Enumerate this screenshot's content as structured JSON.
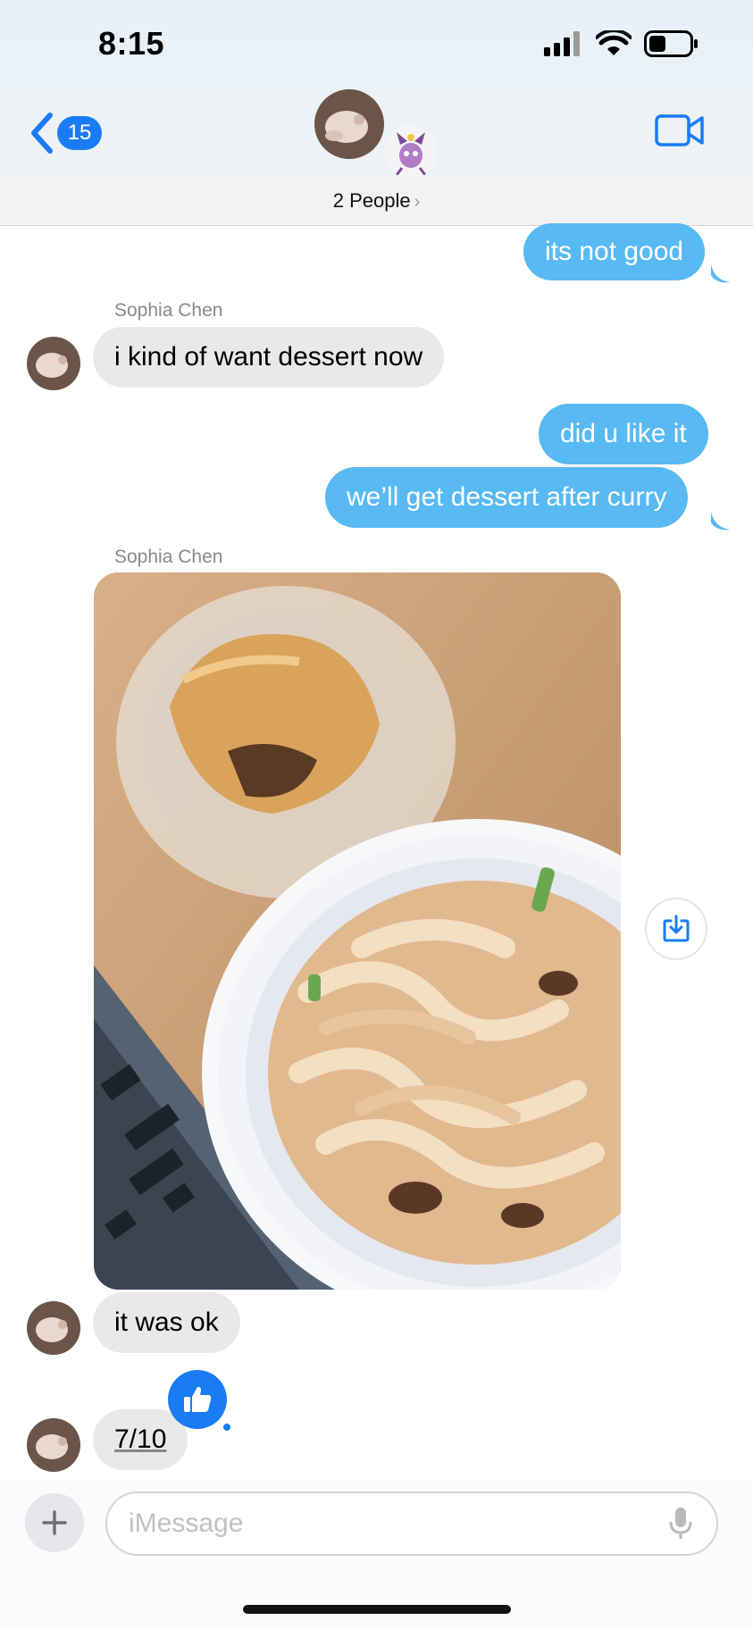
{
  "status_bar": {
    "time": "8:15"
  },
  "header": {
    "back_count": "15",
    "people_label": "2 People",
    "chevron": "›"
  },
  "messages": [
    {
      "direction": "out",
      "text": "its not good"
    },
    {
      "sender": "Sophia Chen"
    },
    {
      "direction": "in",
      "text": "i kind of want dessert now"
    },
    {
      "direction": "out",
      "text": "did u like it"
    },
    {
      "direction": "out",
      "text": "we’ll get dessert after curry"
    },
    {
      "sender": "Sophia Chen"
    },
    {
      "direction": "in",
      "type": "photo",
      "description": ""
    },
    {
      "direction": "in",
      "text": "it was ok"
    },
    {
      "direction": "in",
      "text": "7/10",
      "reaction": "thumbs-up-icon"
    }
  ],
  "composer": {
    "placeholder": "iMessage"
  },
  "colors": {
    "accent": "#1a7cf4",
    "outgoing_bubble": "#58b9f3",
    "incoming_bubble": "#e9e9eb"
  },
  "icons": [
    "back-chevron-icon",
    "video-camera-icon",
    "save-photo-icon",
    "thumbs-up-icon",
    "plus-icon",
    "microphone-icon",
    "signal-icon",
    "wifi-icon",
    "battery-icon"
  ]
}
